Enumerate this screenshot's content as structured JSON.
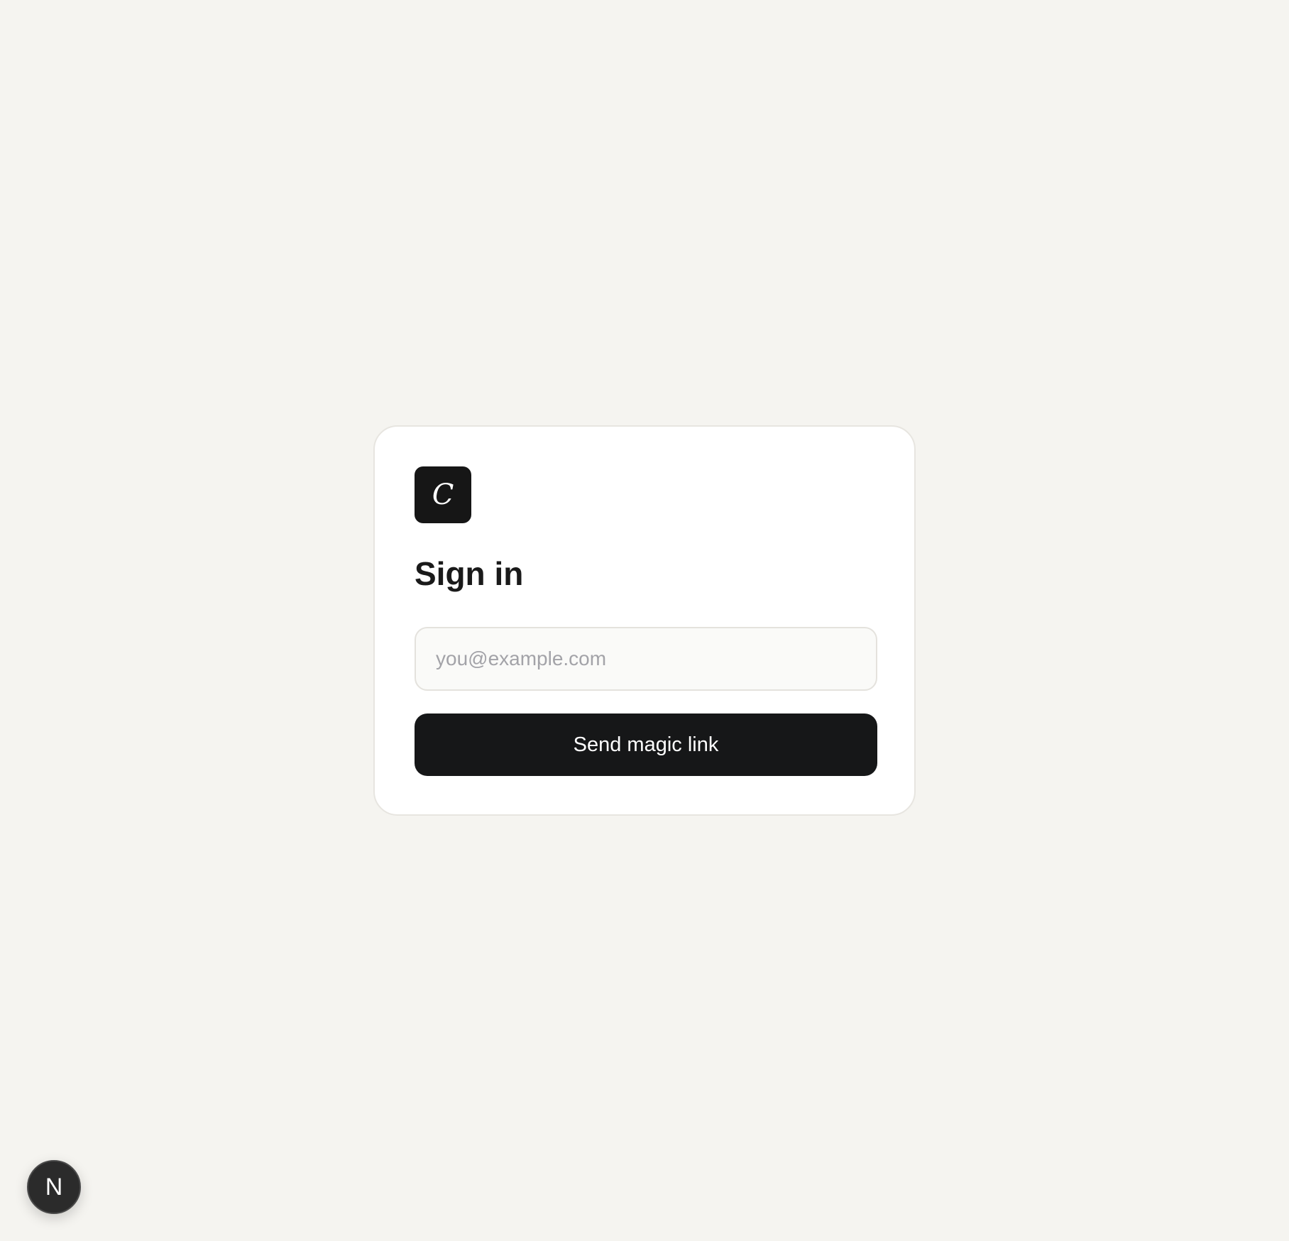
{
  "colors": {
    "page_background": "#f5f4f0",
    "card_background": "#ffffff",
    "primary_button": "#161718",
    "logo_background": "#161616",
    "placeholder": "#a3a3a8"
  },
  "logo": {
    "letter": "C",
    "icon": "app-logo-icon"
  },
  "signin": {
    "title": "Sign in",
    "email_placeholder": "you@example.com",
    "email_value": "",
    "submit_label": "Send magic link"
  },
  "dev_badge": {
    "letter": "N",
    "icon": "nextjs-icon"
  }
}
